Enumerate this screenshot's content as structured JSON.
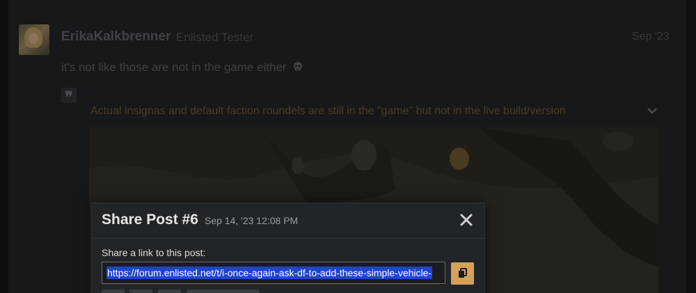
{
  "post": {
    "username": "ErikaKalkbrenner",
    "user_title": "Enlisted Tester",
    "date": "Sep '23",
    "text": "it's not like those are not in the game either",
    "quote": {
      "text": "Actual insignas and default faction roundels are still in the \"game\" but not in the live build/version"
    }
  },
  "share_modal": {
    "title": "Share Post #6",
    "date": "Sep 14, '23 12:08 PM",
    "label": "Share a link to this post:",
    "link": "https://forum.enlisted.net/t/i-once-again-ask-df-to-add-these-simple-vehicle-"
  },
  "icons": {
    "skull": "skull-icon",
    "quote": "quote-icon",
    "chevron": "chevron-down-icon",
    "close": "close-icon",
    "copy": "copy-icon"
  },
  "colors": {
    "accent": "#d7a157",
    "selection": "#1e46c8",
    "modal_bg": "#222528"
  }
}
